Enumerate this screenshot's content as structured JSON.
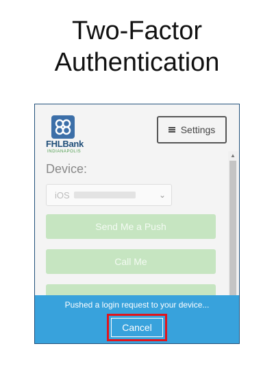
{
  "page": {
    "title_line1": "Two-Factor",
    "title_line2": "Authentication"
  },
  "logo": {
    "name": "FHLBank",
    "subtitle": "INDIANAPOLIS"
  },
  "header": {
    "settings_label": "Settings",
    "settings_icon": "hamburger-icon"
  },
  "form": {
    "device_label": "Device:",
    "device_value": "iOS"
  },
  "actions": {
    "push_label": "Send Me a Push",
    "call_label": "Call Me"
  },
  "status": {
    "message": "Pushed a login request to your device...",
    "cancel_label": "Cancel"
  },
  "colors": {
    "accent_blue": "#38a2dc",
    "button_green": "#c6e5c1",
    "highlight_red": "#e2141b",
    "frame_border": "#1f4e79"
  }
}
